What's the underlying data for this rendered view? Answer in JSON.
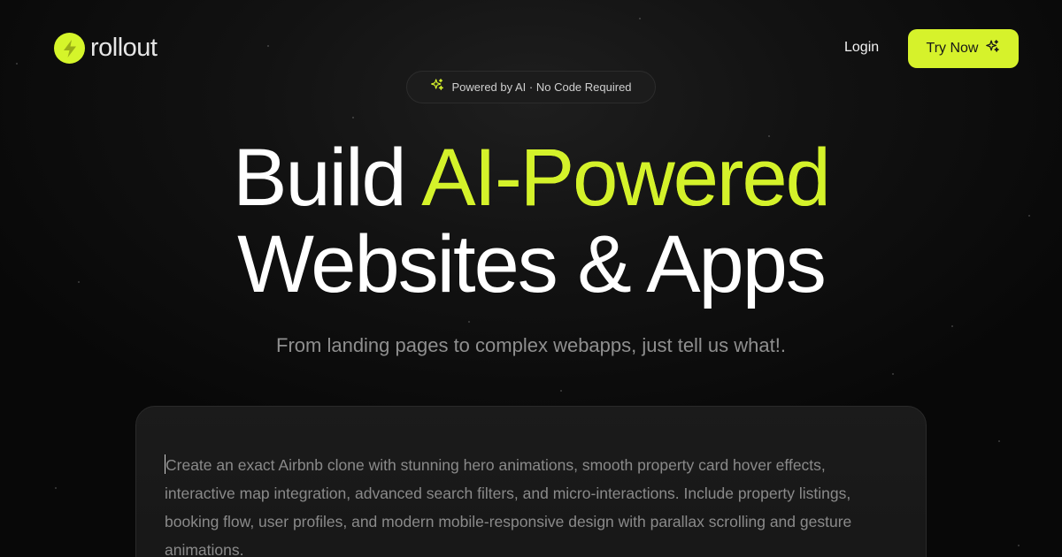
{
  "header": {
    "logo_text": "rollout",
    "login_label": "Login",
    "try_label": "Try Now"
  },
  "badge": {
    "text": "Powered by AI · No Code Required"
  },
  "hero": {
    "title_part1": "Build ",
    "title_accent": "AI-Powered",
    "title_line2": "Websites & Apps",
    "subtitle": "From landing pages to complex webapps, just tell us what!."
  },
  "prompt": {
    "text": "Create an exact Airbnb clone with stunning hero animations, smooth property card hover effects, interactive map integration, advanced search filters, and micro-interactions. Include property listings, booking flow, user profiles, and modern mobile-responsive design with parallax scrolling and gesture animations."
  },
  "icons": {
    "logo": "lightning-bolt-icon",
    "try": "sparkles-icon",
    "badge": "sparkles-icon"
  },
  "colors": {
    "accent": "#d6f22b",
    "background": "#070707",
    "muted_text": "#8f8f8f"
  }
}
